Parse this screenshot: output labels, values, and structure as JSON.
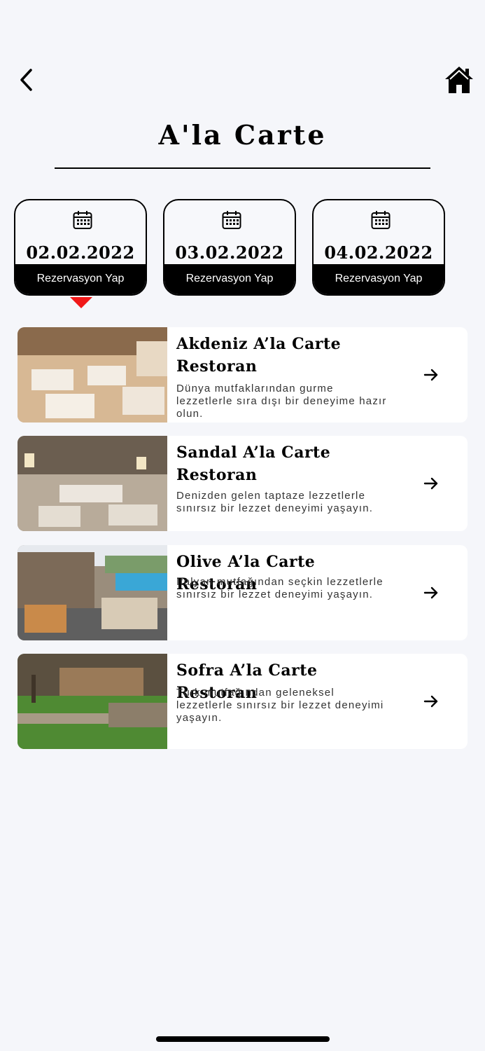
{
  "header": {
    "title": "A'la Carte"
  },
  "dates": [
    {
      "date": "02.02.2022",
      "action": "Rezervasyon Yap",
      "selected": true
    },
    {
      "date": "03.02.2022",
      "action": "Rezervasyon Yap",
      "selected": false
    },
    {
      "date": "04.02.2022",
      "action": "Rezervasyon Yap",
      "selected": false
    }
  ],
  "restaurants": [
    {
      "name_line1": "Akdeniz A’la Carte",
      "name_line2": "Restoran",
      "description": "Dünya mutfaklarından gurme lezzetlerle sıra dışı bir deneyime hazır olun."
    },
    {
      "name_line1": "Sandal A’la Carte",
      "name_line2": "Restoran",
      "description": "Denizden gelen taptaze lezzetlerle sınırsız bir lezzet deneyimi yaşayın."
    },
    {
      "name_line1": "Olive A’la Carte Restoran",
      "name_line2": "",
      "description": "Italyan mutfağından seçkin lezzetlerle sınırsız bir lezzet deneyimi yaşayın."
    },
    {
      "name_line1": "Sofra A’la Carte Restoran",
      "name_line2": "",
      "description": "Türk mutfağından geleneksel lezzetlerle sınırsız bir lezzet deneyimi yaşayın."
    }
  ],
  "icons": {
    "back": "chevron-left-icon",
    "home": "home-icon",
    "calendar": "calendar-icon",
    "arrow": "arrow-right-icon"
  },
  "colors": {
    "background": "#f5f6fa",
    "accent": "#f01818",
    "dark": "#000000",
    "card": "#ffffff"
  }
}
